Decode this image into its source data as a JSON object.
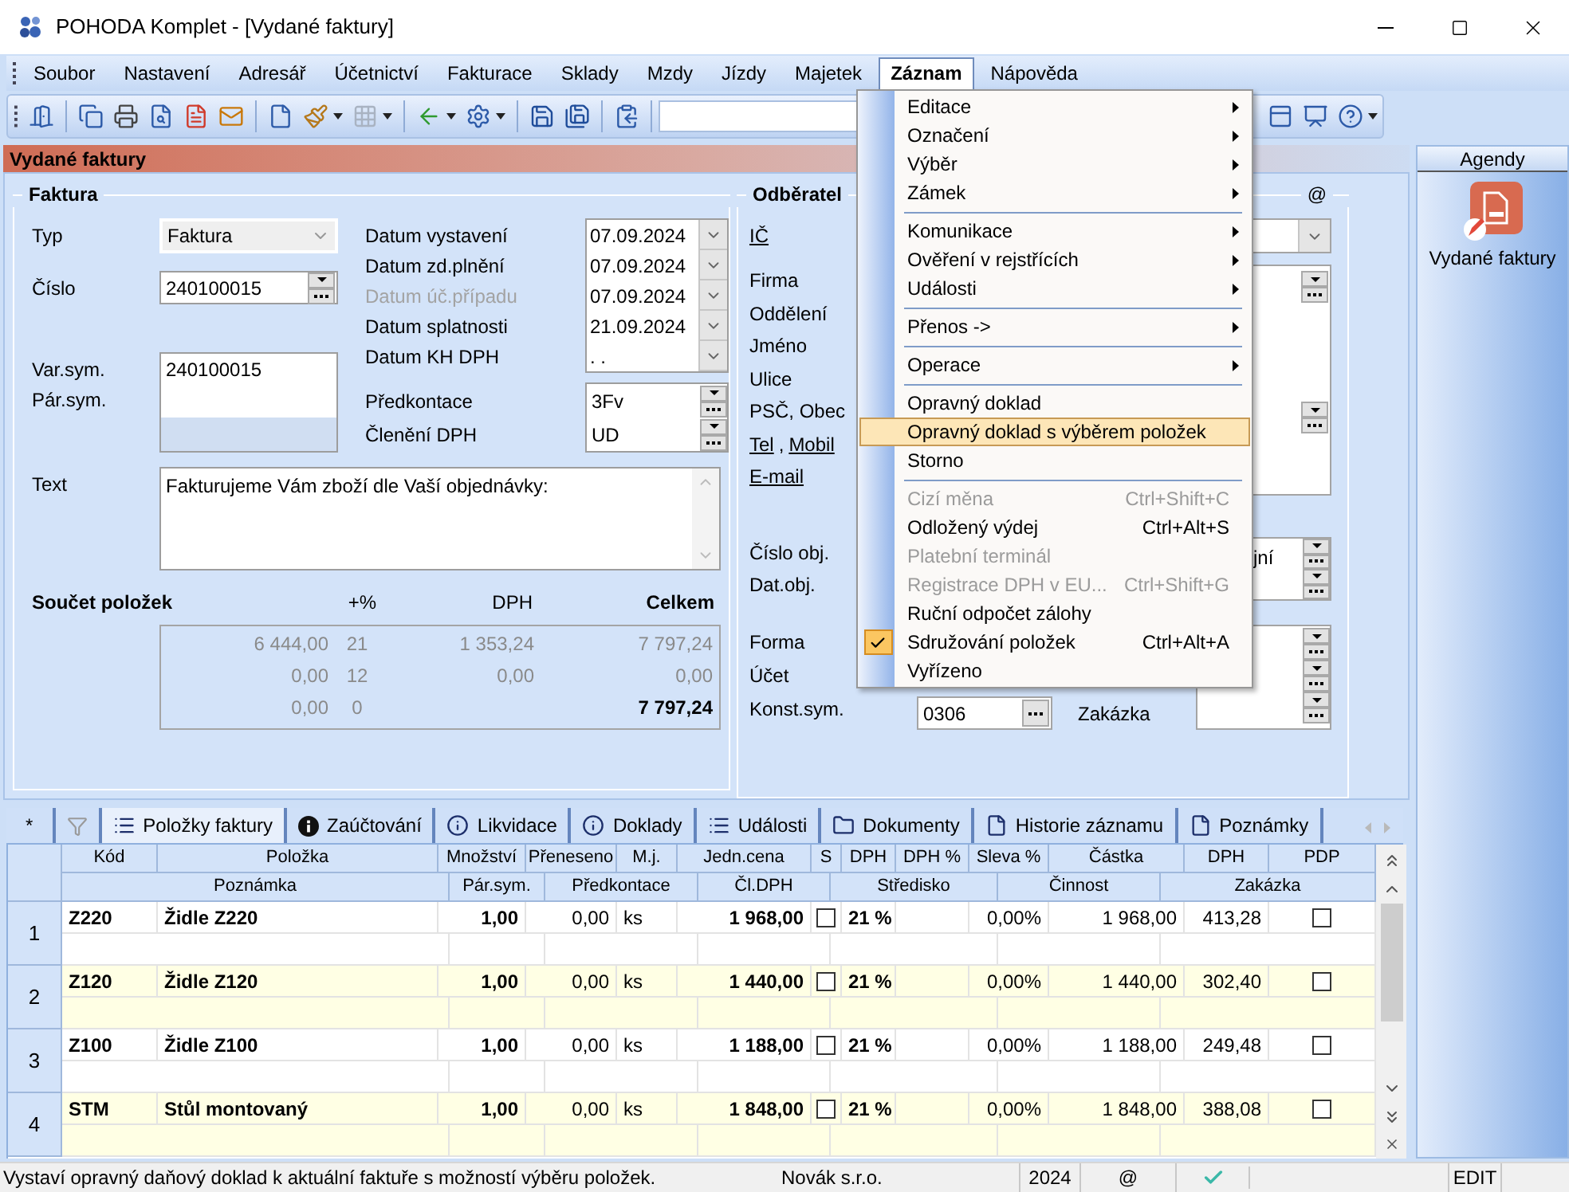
{
  "window": {
    "title": "POHODA Komplet - [Vydané faktury]"
  },
  "menu_bar": [
    {
      "label": "Soubor",
      "selected": false
    },
    {
      "label": "Nastavení",
      "selected": false
    },
    {
      "label": "Adresář",
      "selected": false
    },
    {
      "label": "Účetnictví",
      "selected": false
    },
    {
      "label": "Fakturace",
      "selected": false
    },
    {
      "label": "Sklady",
      "selected": false
    },
    {
      "label": "Mzdy",
      "selected": false
    },
    {
      "label": "Jízdy",
      "selected": false
    },
    {
      "label": "Majetek",
      "selected": false
    },
    {
      "label": "Záznam",
      "selected": true
    },
    {
      "label": "Nápověda",
      "selected": false
    }
  ],
  "toolbar": [
    {
      "kind": "exit",
      "disabled": false,
      "has_menu": false
    },
    {
      "kind": "separator"
    },
    {
      "kind": "copy",
      "disabled": false,
      "has_menu": false
    },
    {
      "kind": "print",
      "disabled": false,
      "has_menu": false
    },
    {
      "kind": "preview",
      "disabled": false,
      "has_menu": false
    },
    {
      "kind": "pdf",
      "disabled": false,
      "has_menu": false
    },
    {
      "kind": "email",
      "disabled": false,
      "has_menu": false
    },
    {
      "kind": "separator"
    },
    {
      "kind": "new",
      "disabled": false,
      "has_menu": false
    },
    {
      "kind": "brush",
      "disabled": false,
      "has_menu": true
    },
    {
      "kind": "grid",
      "disabled": true,
      "has_menu": true
    },
    {
      "kind": "separator"
    },
    {
      "kind": "back",
      "disabled": false,
      "has_menu": true
    },
    {
      "kind": "gear",
      "disabled": false,
      "has_menu": true
    },
    {
      "kind": "separator"
    },
    {
      "kind": "save",
      "disabled": false,
      "has_menu": false
    },
    {
      "kind": "save_all",
      "disabled": false,
      "has_menu": false
    },
    {
      "kind": "separator"
    },
    {
      "kind": "clipboard",
      "disabled": false,
      "has_menu": false
    },
    {
      "kind": "separator"
    }
  ],
  "toolbar_right": [
    {
      "kind": "window",
      "disabled": false,
      "has_menu": false
    },
    {
      "kind": "presentation",
      "disabled": false,
      "has_menu": false
    },
    {
      "kind": "help",
      "disabled": false,
      "has_menu": true
    }
  ],
  "agenda_title": "Vydané faktury",
  "invoice": {
    "title": "Faktura",
    "type": {
      "label": "Typ",
      "value": "Faktura"
    },
    "number": {
      "label": "Číslo",
      "value": "240100015"
    },
    "symbols": {
      "labels": [
        "Var.sym.",
        "Pár.sym."
      ],
      "value": "240100015"
    },
    "dates": [
      {
        "label": "Datum vystavení",
        "value": "07.09.2024",
        "disabled": false
      },
      {
        "label": "Datum zd.plnění",
        "value": "07.09.2024",
        "disabled": false
      },
      {
        "label": "Datum úč.případu",
        "value": "07.09.2024",
        "disabled": true
      },
      {
        "label": "Datum splatnosti",
        "value": "21.09.2024",
        "disabled": false
      },
      {
        "label": "Datum KH DPH",
        "value": ". .",
        "disabled": false
      }
    ],
    "accounting": [
      {
        "label": "Předkontace",
        "value": "3Fv"
      },
      {
        "label": "Členění DPH",
        "value": "UD"
      }
    ],
    "text": {
      "label": "Text",
      "value": "Fakturujeme Vám zboží dle Vaší objednávky:"
    }
  },
  "sums": {
    "title": "Součet položek",
    "columns": [
      "+%",
      "DPH",
      "Celkem"
    ],
    "rows": [
      {
        "kind": "rate",
        "base": "6 444,00",
        "rate": "21",
        "vat": "1 353,24",
        "total": "7 797,24"
      },
      {
        "kind": "rate",
        "base": "0,00",
        "rate": "12",
        "vat": "0,00",
        "total": "0,00"
      },
      {
        "kind": "grand",
        "base": "0,00",
        "rate": "0",
        "total": "7 797,24"
      }
    ]
  },
  "customer": {
    "title": "Odběratel",
    "email_mark": "@",
    "label_groups": [
      [
        {
          "parts": [
            {
              "text": "IČ",
              "link": true
            }
          ]
        }
      ],
      [
        {
          "parts": [
            {
              "text": "Firma",
              "link": false
            }
          ]
        },
        {
          "parts": [
            {
              "text": "Oddělení",
              "link": false
            }
          ]
        },
        {
          "parts": [
            {
              "text": "Jméno",
              "link": false
            }
          ]
        },
        {
          "parts": [
            {
              "text": "Ulice",
              "link": false
            }
          ]
        },
        {
          "parts": [
            {
              "text": "PSČ, Obec",
              "link": false
            }
          ]
        },
        {
          "parts": [
            {
              "text": "Tel",
              "link": true
            },
            {
              "text": ",",
              "link": false
            },
            {
              "text": "Mobil",
              "link": true
            }
          ]
        },
        {
          "parts": [
            {
              "text": "E-mail",
              "link": true
            }
          ]
        }
      ],
      [
        {
          "parts": [
            {
              "text": "Číslo obj.",
              "link": false
            }
          ]
        },
        {
          "parts": [
            {
              "text": "Dat.obj.",
              "link": false
            }
          ]
        }
      ],
      [
        {
          "parts": [
            {
              "text": "Forma",
              "link": false
            }
          ]
        },
        {
          "parts": [
            {
              "text": "Účet",
              "link": false
            }
          ]
        },
        {
          "parts": [
            {
              "text": "Konst.sym.",
              "link": false
            }
          ]
        }
      ]
    ],
    "order_value": "jní",
    "constant_symbol": "0306",
    "job_label": "Zakázka"
  },
  "context_menu": {
    "items": [
      {
        "kind": "submenu",
        "label": "Editace",
        "disabled": false,
        "checked": false,
        "selected": false
      },
      {
        "kind": "submenu",
        "label": "Označení",
        "disabled": false,
        "checked": false,
        "selected": false
      },
      {
        "kind": "submenu",
        "label": "Výběr",
        "disabled": false,
        "checked": false,
        "selected": false
      },
      {
        "kind": "submenu",
        "label": "Zámek",
        "disabled": false,
        "checked": false,
        "selected": false
      },
      {
        "kind": "separator"
      },
      {
        "kind": "submenu",
        "label": "Komunikace",
        "disabled": false,
        "checked": false,
        "selected": false
      },
      {
        "kind": "submenu",
        "label": "Ověření v rejstřících",
        "disabled": false,
        "checked": false,
        "selected": false
      },
      {
        "kind": "submenu",
        "label": "Události",
        "disabled": false,
        "checked": false,
        "selected": false
      },
      {
        "kind": "separator"
      },
      {
        "kind": "submenu",
        "label": "Přenos ->",
        "disabled": false,
        "checked": false,
        "selected": false
      },
      {
        "kind": "separator"
      },
      {
        "kind": "submenu",
        "label": "Operace",
        "disabled": false,
        "checked": false,
        "selected": false
      },
      {
        "kind": "separator"
      },
      {
        "kind": "command",
        "label": "Opravný doklad",
        "disabled": false,
        "checked": false,
        "selected": false
      },
      {
        "kind": "command",
        "label": "Opravný doklad s výběrem položek",
        "disabled": false,
        "checked": false,
        "selected": true
      },
      {
        "kind": "command",
        "label": "Storno",
        "disabled": false,
        "checked": false,
        "selected": false
      },
      {
        "kind": "separator"
      },
      {
        "kind": "command",
        "label": "Cizí měna",
        "shortcut": "Ctrl+Shift+C",
        "disabled": true,
        "checked": false,
        "selected": false
      },
      {
        "kind": "command",
        "label": "Odložený výdej",
        "shortcut": "Ctrl+Alt+S",
        "disabled": false,
        "checked": false,
        "selected": false
      },
      {
        "kind": "command",
        "label": "Platební terminál",
        "disabled": true,
        "checked": false,
        "selected": false
      },
      {
        "kind": "command",
        "label": "Registrace DPH v EU...",
        "shortcut": "Ctrl+Shift+G",
        "disabled": true,
        "checked": false,
        "selected": false
      },
      {
        "kind": "command",
        "label": "Ruční odpočet zálohy",
        "disabled": false,
        "checked": false,
        "selected": false
      },
      {
        "kind": "command",
        "label": "Sdružování položek",
        "shortcut": "Ctrl+Alt+A",
        "disabled": false,
        "checked": true,
        "selected": false
      },
      {
        "kind": "command",
        "label": "Vyřízeno",
        "disabled": false,
        "checked": false,
        "selected": false
      }
    ]
  },
  "tabs": [
    {
      "kind": "text",
      "label": "*",
      "selected": false
    },
    {
      "kind": "filter",
      "selected": false
    },
    {
      "kind": "list",
      "label": "Položky faktury",
      "selected": true
    },
    {
      "kind": "info_filled",
      "label": "Zaúčtování",
      "selected": false
    },
    {
      "kind": "info",
      "label": "Likvidace",
      "selected": false
    },
    {
      "kind": "info",
      "label": "Doklady",
      "selected": false
    },
    {
      "kind": "list",
      "label": "Události",
      "selected": false
    },
    {
      "kind": "folder",
      "label": "Dokumenty",
      "selected": false
    },
    {
      "kind": "page",
      "label": "Historie záznamu",
      "selected": false
    },
    {
      "kind": "page",
      "label": "Poznámky",
      "selected": false
    }
  ],
  "items_table": {
    "columns_top": [
      "Kód",
      "Položka",
      "Množství",
      "Přeneseno",
      "M.j.",
      "Jedn.cena",
      "S",
      "DPH",
      "DPH %",
      "Sleva %",
      "Částka",
      "DPH",
      "PDP"
    ],
    "columns_bottom": [
      "Poznámka",
      "Pár.sym.",
      "Předkontace",
      "Čl.DPH",
      "Středisko",
      "Činnost",
      "Zakázka"
    ],
    "rows": [
      {
        "number": "1",
        "code": "Z220",
        "name": "Židle Z220",
        "quantity": "1,00",
        "transferred": "0,00",
        "unit": "ks",
        "unit_price": "1 968,00",
        "s": false,
        "vat_rate": "21 %",
        "discount": "0,00%",
        "amount": "1 968,00",
        "vat": "413,28",
        "pdp": false
      },
      {
        "number": "2",
        "code": "Z120",
        "name": "Židle Z120",
        "quantity": "1,00",
        "transferred": "0,00",
        "unit": "ks",
        "unit_price": "1 440,00",
        "s": false,
        "vat_rate": "21 %",
        "discount": "0,00%",
        "amount": "1 440,00",
        "vat": "302,40",
        "pdp": false
      },
      {
        "number": "3",
        "code": "Z100",
        "name": "Židle Z100",
        "quantity": "1,00",
        "transferred": "0,00",
        "unit": "ks",
        "unit_price": "1 188,00",
        "s": false,
        "vat_rate": "21 %",
        "discount": "0,00%",
        "amount": "1 188,00",
        "vat": "249,48",
        "pdp": false
      },
      {
        "number": "4",
        "code": "STM",
        "name": "Stůl montovaný",
        "quantity": "1,00",
        "transferred": "0,00",
        "unit": "ks",
        "unit_price": "1 848,00",
        "s": false,
        "vat_rate": "21 %",
        "discount": "0,00%",
        "amount": "1 848,00",
        "vat": "388,08",
        "pdp": false
      }
    ]
  },
  "agendas": {
    "title": "Agendy",
    "items": [
      {
        "label": "Vydané faktury"
      }
    ]
  },
  "status_bar": {
    "message": "Vystaví opravný daňový doklad k aktuální faktuře s možností výběru položek.",
    "company": "Novák s.r.o.",
    "year": "2024",
    "email": "@",
    "mode": "EDIT"
  }
}
